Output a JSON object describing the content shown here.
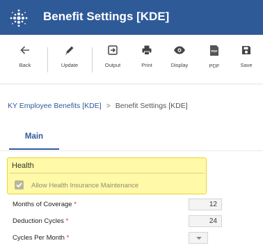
{
  "window": {
    "title": "Benefit Settings [KDE]"
  },
  "toolbar": {
    "back": "Back",
    "update": "Update",
    "output": "Output",
    "print": "Print",
    "display": "Display",
    "pdf": "PDF",
    "pdf_badge": "PDF",
    "save": "Save"
  },
  "breadcrumb": {
    "parent": "KY Employee Benefits [KDE]",
    "separator": ">",
    "current": "Benefit Settings [KDE]"
  },
  "tabs": [
    {
      "label": "Main"
    }
  ],
  "section": {
    "title": "Health",
    "checkbox_label": "Allow Health Insurance Maintenance",
    "checkbox_checked": true
  },
  "fields": [
    {
      "label": "Months of Coverage",
      "required_mark": "*",
      "value": "12"
    },
    {
      "label": "Deduction Cycles",
      "required_mark": "*",
      "value": "24"
    },
    {
      "label": "Cycles Per Month",
      "required_mark": "*",
      "value": ""
    }
  ],
  "colors": {
    "brand": "#2f5a98",
    "highlight": "#fff9a8",
    "required": "#d32f2f"
  }
}
